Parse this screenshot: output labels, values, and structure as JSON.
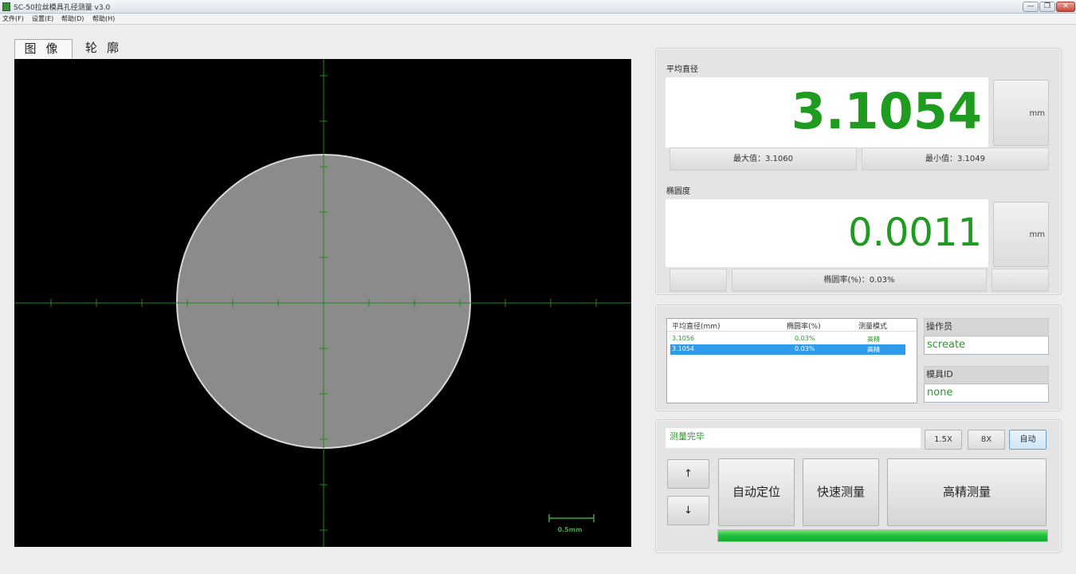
{
  "window": {
    "title": "SC-50拉丝模具孔径测量 v3.0",
    "minimize": "—",
    "restore": "❐",
    "close": "✕"
  },
  "menu": [
    "文件(F)",
    "设置(E)",
    "帮助(D)",
    "帮助(H)"
  ],
  "tabs": {
    "image": "图像",
    "contour": "轮廓"
  },
  "viewer": {
    "scale_label": "0.5mm",
    "crosshair_color": "#1e8a1e"
  },
  "avg_diameter": {
    "label": "平均直径",
    "value": "3.1054",
    "unit": "mm",
    "max": "最大值：3.1060",
    "min": "最小值：3.1049"
  },
  "ovality": {
    "label": "椭圆度",
    "value": "0.0011",
    "unit": "mm",
    "rate": "椭圆率(%)：0.03%"
  },
  "table": {
    "headers": [
      "平均直径(mm)",
      "椭圆率(%)",
      "测量模式"
    ],
    "rows": [
      {
        "diameter": "3.1056",
        "rate": "0.03%",
        "mode": "高精"
      },
      {
        "diameter": "3.1054",
        "rate": "0.03%",
        "mode": "高精"
      }
    ],
    "selected_row": 1
  },
  "operator": {
    "label": "操作员",
    "value": "screate"
  },
  "mold": {
    "label": "模具ID",
    "value": "none"
  },
  "status": {
    "text": "测量完毕"
  },
  "zoom": {
    "b1": "1.5X",
    "b2": "8X",
    "b3": "自动"
  },
  "arrows": {
    "up": "↑",
    "down": "↓"
  },
  "actions": {
    "auto_locate": "自动定位",
    "quick": "快速测量",
    "precise": "高精测量"
  },
  "progress": {
    "fraction": 1.0
  },
  "colors": {
    "value_green": "#1f9b1f",
    "selected_row": "#2f9bea",
    "progress": "#1fbf3a"
  }
}
